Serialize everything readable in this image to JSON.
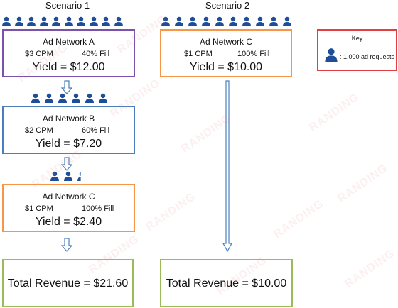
{
  "scenario1": {
    "title": "Scenario 1",
    "networks": [
      {
        "name": "Ad Network A",
        "cpm": "$3 CPM",
        "fill": "40% Fill",
        "yield": "Yield = $12.00",
        "color": "#7b52ab",
        "requests": 10
      },
      {
        "name": "Ad Network B",
        "cpm": "$2 CPM",
        "fill": "60% Fill",
        "yield": "Yield = $7.20",
        "color": "#4a7ebb",
        "requests": 6
      },
      {
        "name": "Ad Network C",
        "cpm": "$1 CPM",
        "fill": "100% Fill",
        "yield": "Yield = $2.40",
        "color": "#f79646",
        "requests": 2.4
      }
    ],
    "total": "Total Revenue = $21.60"
  },
  "scenario2": {
    "title": "Scenario 2",
    "network": {
      "name": "Ad Network C",
      "cpm": "$1 CPM",
      "fill": "100% Fill",
      "yield": "Yield = $10.00",
      "color": "#f79646",
      "requests": 10
    },
    "total": "Total Revenue = $10.00"
  },
  "key": {
    "title": "Key",
    "label": ": 1,000 ad requests",
    "color": "#e04040"
  },
  "colors": {
    "icon": "#1f4e99",
    "total_border": "#9bbb59",
    "arrow": "#4a7ebb"
  },
  "watermark": "RANDING"
}
